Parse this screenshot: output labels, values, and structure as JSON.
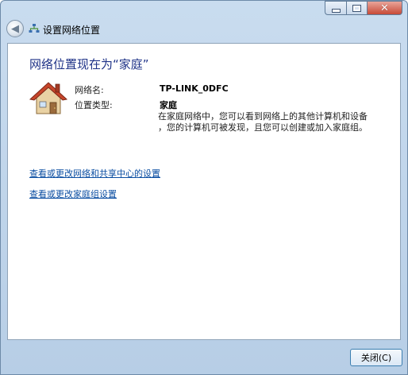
{
  "window": {
    "title": "设置网络位置"
  },
  "main": {
    "heading": "网络位置现在为“家庭”",
    "network_name_label": "网络名:",
    "network_name_value": "TP-LINK_0DFC",
    "location_type_label": "位置类型:",
    "location_type_value": "家庭",
    "description_line1": "在家庭网络中，您可以看到网络上的其他计算机和设备",
    "description_line2": "，您的计算机可被发现，且您可以创建或加入家庭组。",
    "link_network_center": "查看或更改网络和共享中心的设置",
    "link_homegroup": "查看或更改家庭组设置"
  },
  "footer": {
    "close_label": "关闭(C)"
  },
  "colors": {
    "heading": "#1e3287",
    "link": "#0b4ea2",
    "title_bar": "#c9dcef",
    "close_button_red": "#c74a37"
  },
  "icons": {
    "back": "back-arrow-icon",
    "title": "network-icon",
    "location": "home-icon"
  }
}
